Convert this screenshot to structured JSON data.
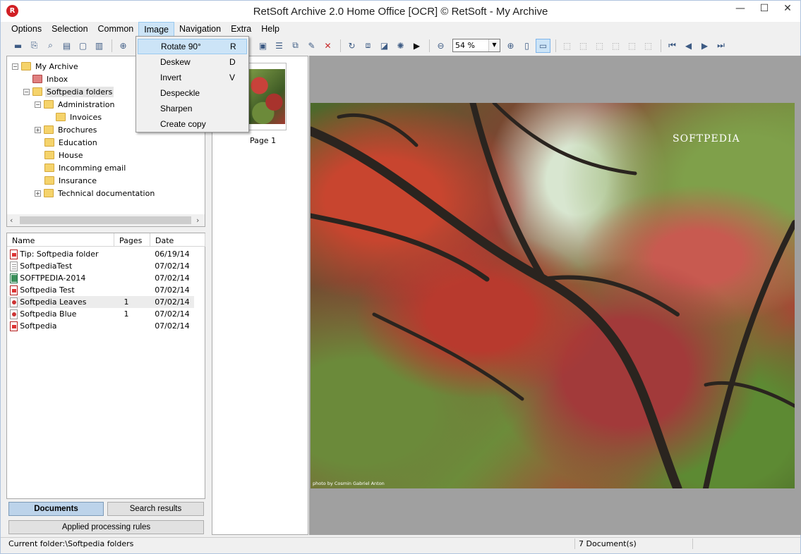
{
  "window": {
    "title": "RetSoft Archive 2.0 Home Office [OCR] © RetSoft - My Archive",
    "app_icon_letter": "R",
    "minimize": "—",
    "maximize": "☐",
    "close": "✕"
  },
  "menu": {
    "items": [
      "Options",
      "Selection",
      "Common",
      "Image",
      "Navigation",
      "Extra",
      "Help"
    ],
    "active": "Image"
  },
  "image_menu": {
    "items": [
      {
        "label": "Rotate 90°",
        "key": "R"
      },
      {
        "label": "Deskew",
        "key": "D"
      },
      {
        "label": "Invert",
        "key": "V"
      },
      {
        "label": "Despeckle",
        "key": ""
      },
      {
        "label": "Sharpen",
        "key": ""
      },
      {
        "label": "Create copy",
        "key": ""
      }
    ],
    "highlighted": "Rotate 90°"
  },
  "toolbar": {
    "zoom_value": "54 %"
  },
  "tree": {
    "root": "My Archive",
    "inbox": "Inbox",
    "folders": "Softpedia folders",
    "administration": "Administration",
    "invoices": "Invoices",
    "brochures": "Brochures",
    "education": "Education",
    "house": "House",
    "incomming_email": "Incomming email",
    "insurance": "Insurance",
    "technical": "Technical documentation"
  },
  "documents": {
    "columns": {
      "name": "Name",
      "pages": "Pages",
      "date": "Date"
    },
    "rows": [
      {
        "name": "Tip: Softpedia folder",
        "pages": "",
        "date": "06/19/14",
        "type": "pdf"
      },
      {
        "name": "SoftpediaTest",
        "pages": "",
        "date": "07/02/14",
        "type": "txt"
      },
      {
        "name": "SOFTPEDIA-2014",
        "pages": "",
        "date": "07/02/14",
        "type": "xls"
      },
      {
        "name": "Softpedia Test",
        "pages": "",
        "date": "07/02/14",
        "type": "pdf"
      },
      {
        "name": "Softpedia Leaves",
        "pages": "1",
        "date": "07/02/14",
        "type": "img"
      },
      {
        "name": "Softpedia Blue",
        "pages": "1",
        "date": "07/02/14",
        "type": "img"
      },
      {
        "name": "Softpedia",
        "pages": "",
        "date": "07/02/14",
        "type": "pdf"
      }
    ]
  },
  "buttons": {
    "documents": "Documents",
    "search_results": "Search results",
    "applied_rules": "Applied processing rules"
  },
  "thumbnail": {
    "caption": "Page 1"
  },
  "preview": {
    "watermark": "SOFTPEDIA",
    "credit": "photo by Cosmin Gabriel Anton"
  },
  "status": {
    "folder": "Current folder:\\Softpedia folders",
    "count": "7 Document(s)"
  }
}
